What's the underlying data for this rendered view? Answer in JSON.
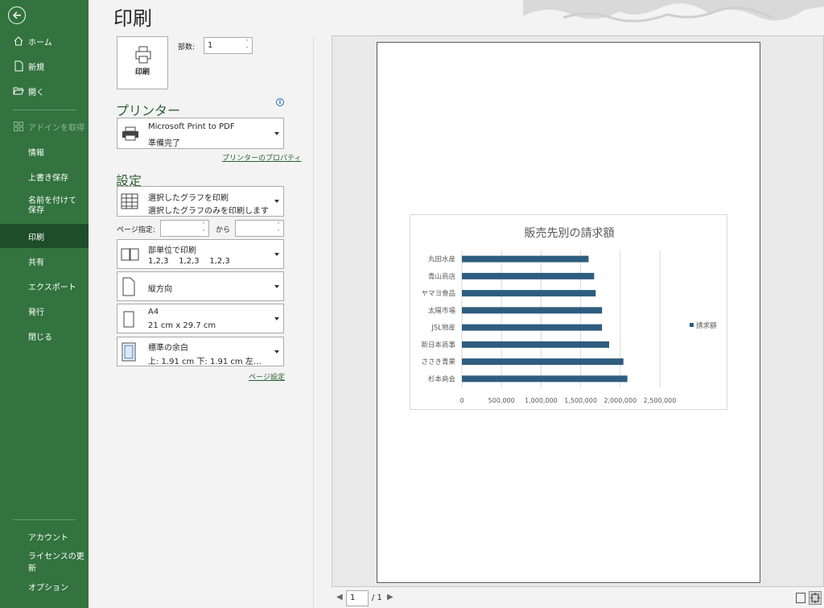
{
  "sidebar": {
    "items": [
      {
        "label": "ホーム",
        "icon": "home-icon"
      },
      {
        "label": "新規",
        "icon": "new-document-icon"
      },
      {
        "label": "開く",
        "icon": "open-folder-icon"
      },
      {
        "label": "アドインを取得",
        "icon": "addins-icon",
        "disabled": true
      },
      {
        "label": "情報"
      },
      {
        "label": "上書き保存"
      },
      {
        "label": "名前を付けて保存"
      },
      {
        "label": "印刷",
        "active": true
      },
      {
        "label": "共有"
      },
      {
        "label": "エクスポート"
      },
      {
        "label": "発行"
      },
      {
        "label": "閉じる"
      },
      {
        "label": "アカウント"
      },
      {
        "label": "ライセンスの更新"
      },
      {
        "label": "オプション"
      }
    ]
  },
  "page_title": "印刷",
  "print_button": {
    "label": "印刷"
  },
  "copies": {
    "label": "部数:",
    "value": "1"
  },
  "printer": {
    "heading": "プリンター",
    "name": "Microsoft Print to PDF",
    "status": "準備完了",
    "properties_link": "プリンターのプロパティ"
  },
  "settings": {
    "heading": "設定",
    "what_to_print": {
      "line1": "選択したグラフを印刷",
      "line2": "選択したグラフのみを印刷します"
    },
    "pages": {
      "label": "ページ指定:",
      "from_value": "",
      "to_label": "から",
      "to_value": ""
    },
    "collation": {
      "line1": "部単位で印刷",
      "line2": "1,2,3    1,2,3    1,2,3"
    },
    "orientation": {
      "line1": "縦方向"
    },
    "paper": {
      "line1": "A4",
      "line2": "21 cm x 29.7 cm"
    },
    "margins": {
      "line1": "標準の余白",
      "line2": "上: 1.91 cm 下: 1.91 cm 左…"
    },
    "page_setup_link": "ページ設定"
  },
  "preview": {
    "current_page": "1",
    "total_pages": "/ 1"
  },
  "chart_data": {
    "type": "bar",
    "title": "販売先別の請求額",
    "categories": [
      "丸田水産",
      "青山商店",
      "ヤマヨ食品",
      "太陽市場",
      "JSL物産",
      "新日本商事",
      "ささき青果",
      "杉本商会"
    ],
    "values": [
      1600000,
      1670000,
      1690000,
      1770000,
      1770000,
      1860000,
      2040000,
      2090000
    ],
    "xlim": [
      0,
      2500000
    ],
    "xticks": [
      "0",
      "500,000",
      "1,000,000",
      "1,500,000",
      "2,000,000",
      "2,500,000"
    ],
    "legend": {
      "label": "請求額",
      "position": "right"
    },
    "series_color": "#2e5d7f",
    "grid": true
  },
  "colors": {
    "sidebar": "#32733f",
    "active": "#1e4d29",
    "accent": "#2b5f33"
  }
}
